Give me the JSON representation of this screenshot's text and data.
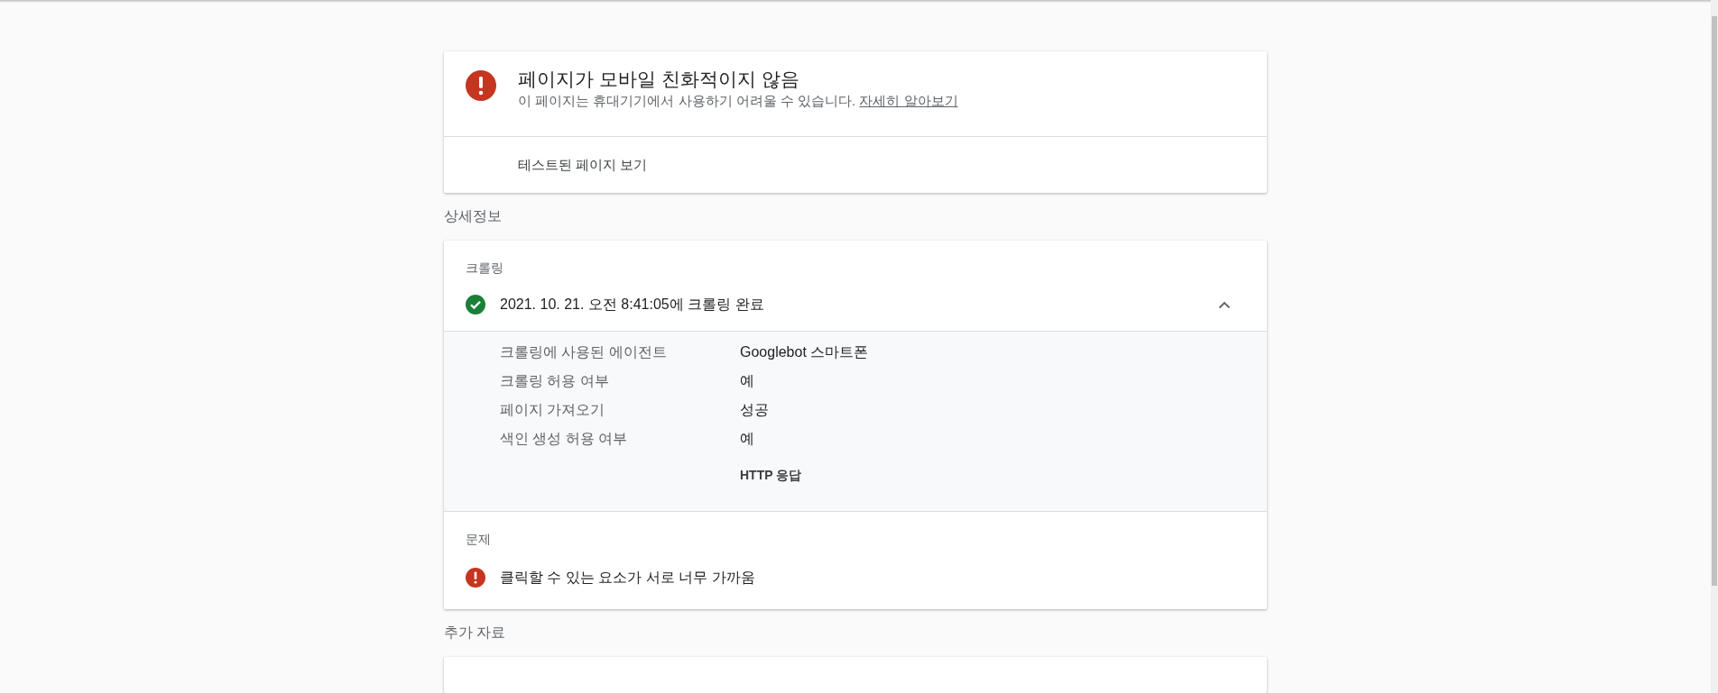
{
  "verdict": {
    "kind": "error",
    "title": "페이지가 모바일 친화적이지 않음",
    "description": "이 페이지는 휴대기기에서 사용하기 어려울 수 있습니다.",
    "link": "자세히 알아보기",
    "action": "테스트된 페이지 보기"
  },
  "details_heading": "상세정보",
  "crawl": {
    "heading": "크롤링",
    "kind": "ok",
    "summary": "2021. 10. 21. 오전 8:41:05에 크롤링 완료",
    "expanded": true,
    "rows": [
      {
        "label": "크롤링에 사용된 에이전트",
        "value": "Googlebot 스마트폰"
      },
      {
        "label": "크롤링 허용 여부",
        "value": "예"
      },
      {
        "label": "페이지 가져오기",
        "value": "성공"
      },
      {
        "label": "색인 생성 허용 여부",
        "value": "예"
      }
    ],
    "http_response": "HTTP 응답"
  },
  "issues": {
    "heading": "문제",
    "items": [
      {
        "kind": "error",
        "text": "클릭할 수 있는 요소가 서로 너무 가까움"
      }
    ]
  },
  "resources_heading": "추가 자료"
}
